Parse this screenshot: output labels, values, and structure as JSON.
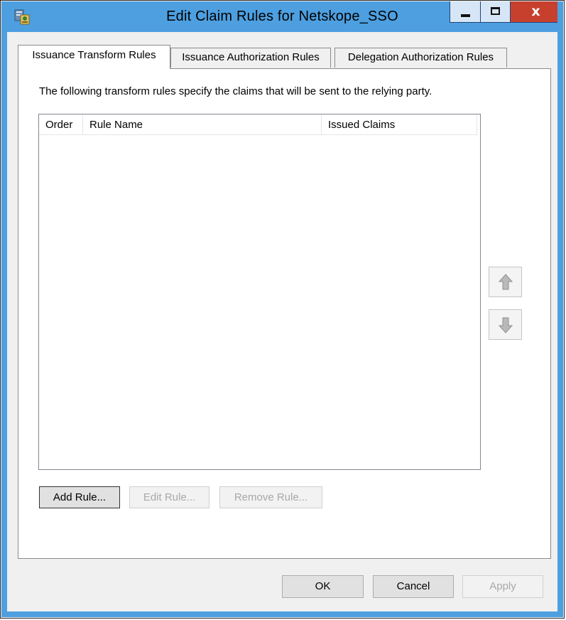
{
  "window": {
    "title": "Edit Claim Rules for Netskope_SSO",
    "minimize_icon": "minimize-icon",
    "maximize_icon": "maximize-icon",
    "close_glyph": "x"
  },
  "tabs": [
    {
      "label": "Issuance Transform Rules",
      "active": true
    },
    {
      "label": "Issuance Authorization Rules",
      "active": false
    },
    {
      "label": "Delegation Authorization Rules",
      "active": false
    }
  ],
  "panel": {
    "description": "The following transform rules specify the claims that will be sent to the relying party.",
    "columns": [
      "Order",
      "Rule Name",
      "Issued Claims"
    ],
    "rows": [],
    "move_up_icon": "arrow-up-icon",
    "move_down_icon": "arrow-down-icon",
    "buttons": {
      "add": "Add Rule...",
      "edit": "Edit Rule...",
      "remove": "Remove Rule..."
    }
  },
  "dialog_buttons": {
    "ok": "OK",
    "cancel": "Cancel",
    "apply": "Apply"
  },
  "colors": {
    "titlebar": "#4d9fe0",
    "close": "#c7402e"
  }
}
